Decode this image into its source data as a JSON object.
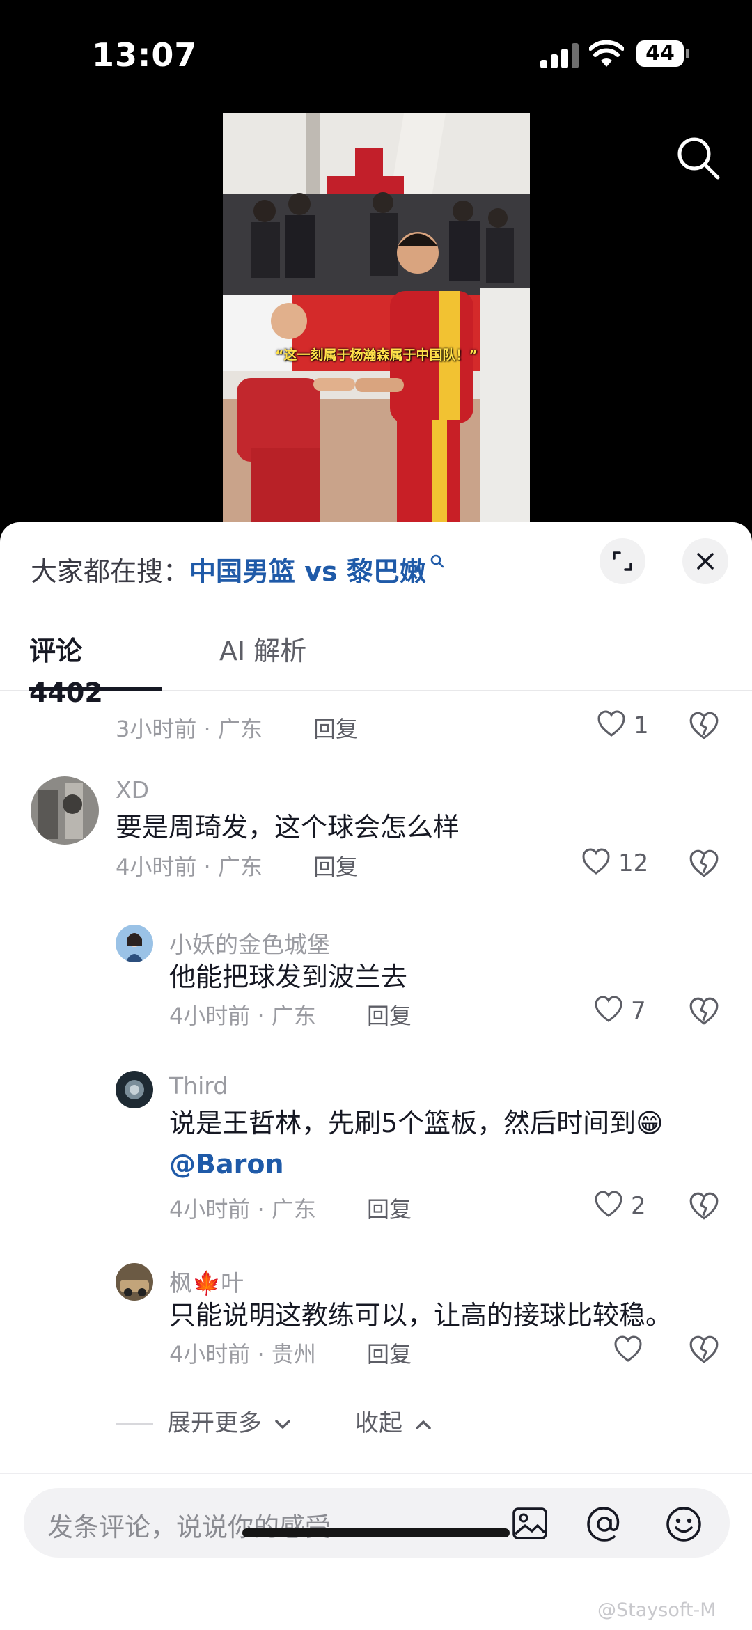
{
  "status_bar": {
    "time": "13:07",
    "battery": "44"
  },
  "video": {
    "caption": "“这一刻属于杨瀚森属于中国队！”"
  },
  "sheet": {
    "trend_lead": "大家都在搜：",
    "trend_topic": "中国男篮 vs 黎巴嫩",
    "tabs": [
      {
        "label": "评论 4402"
      },
      {
        "label": "AI 解析"
      }
    ]
  },
  "comments": [
    {
      "meta": "3小时前 · 广东",
      "reply": "回复",
      "likes": "1"
    },
    {
      "user": "XD",
      "text": "要是周琦发，这个球会怎么样",
      "meta": "4小时前 · 广东",
      "reply": "回复",
      "likes": "12"
    },
    {
      "user": "小妖的金色城堡",
      "text": "他能把球发到波兰去",
      "meta": "4小时前 · 广东",
      "reply": "回复",
      "likes": "7"
    },
    {
      "user": "Third",
      "text": "说是王哲林，先刷5个篮板，然后时间到😁",
      "mention": "@Baron",
      "meta": "4小时前 · 广东",
      "reply": "回复",
      "likes": "2"
    },
    {
      "user": "枫🍁叶",
      "text": "只能说明这教练可以，让高的接球比较稳。",
      "meta": "4小时前 · 贵州",
      "reply": "回复",
      "likes": ""
    }
  ],
  "expand": {
    "more": "展开更多",
    "collapse": "收起"
  },
  "input": {
    "placeholder": "发条评论，说说你的感受"
  },
  "watermark": "@Staysoft-M",
  "colors": {
    "link": "#1f5aa8",
    "text": "#161823",
    "muted": "#9a9ba1"
  }
}
